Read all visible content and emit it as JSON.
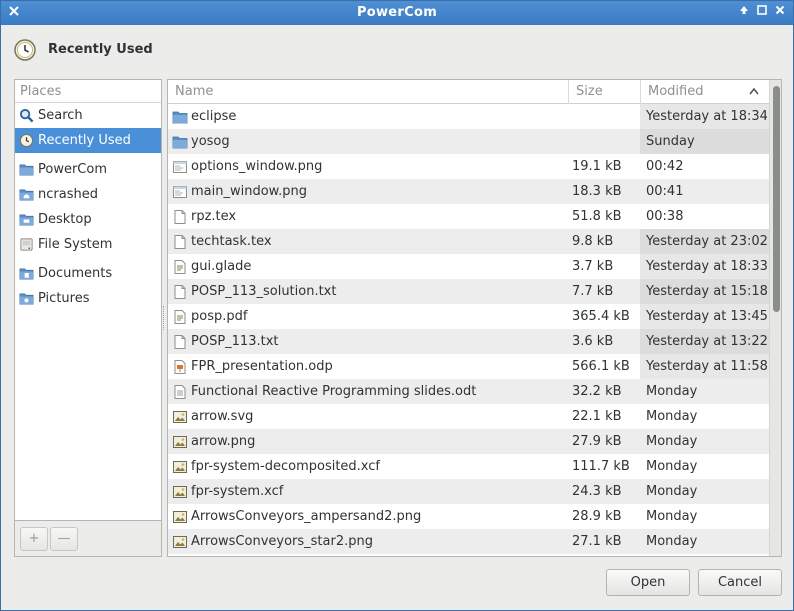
{
  "window": {
    "title": "PowerCom"
  },
  "header": {
    "title": "Recently Used"
  },
  "places": {
    "heading": "Places",
    "items": [
      {
        "label": "Search",
        "icon": "search-icon"
      },
      {
        "label": "Recently Used",
        "icon": "clock-icon",
        "selected": true
      },
      {
        "label": "PowerCom",
        "icon": "folder-icon"
      },
      {
        "label": "ncrashed",
        "icon": "folder-icon"
      },
      {
        "label": "Desktop",
        "icon": "folder-icon"
      },
      {
        "label": "File System",
        "icon": "drive-icon"
      },
      {
        "label": "Documents",
        "icon": "folder-icon"
      },
      {
        "label": "Pictures",
        "icon": "folder-icon"
      }
    ],
    "add_label": "+",
    "remove_label": "—"
  },
  "columns": {
    "name": "Name",
    "size": "Size",
    "modified": "Modified"
  },
  "files": [
    {
      "name": "eclipse",
      "size": "",
      "modified": "Yesterday at 18:34",
      "icon": "folder-icon"
    },
    {
      "name": "yosog",
      "size": "",
      "modified": "Sunday",
      "icon": "folder-icon"
    },
    {
      "name": "options_window.png",
      "size": "19.1 kB",
      "modified": "00:42",
      "icon": "image-icon"
    },
    {
      "name": "main_window.png",
      "size": "18.3 kB",
      "modified": "00:41",
      "icon": "image-icon"
    },
    {
      "name": "rpz.tex",
      "size": "51.8 kB",
      "modified": "00:38",
      "icon": "text-file-icon"
    },
    {
      "name": "techtask.tex",
      "size": "9.8 kB",
      "modified": "Yesterday at 23:02",
      "icon": "text-file-icon"
    },
    {
      "name": "gui.glade",
      "size": "3.7 kB",
      "modified": "Yesterday at 18:33",
      "icon": "script-file-icon"
    },
    {
      "name": "POSP_113_solution.txt",
      "size": "7.7 kB",
      "modified": "Yesterday at 15:18",
      "icon": "text-file-icon"
    },
    {
      "name": "posp.pdf",
      "size": "365.4 kB",
      "modified": "Yesterday at 13:45",
      "icon": "script-file-icon"
    },
    {
      "name": "POSP_113.txt",
      "size": "3.6 kB",
      "modified": "Yesterday at 13:22",
      "icon": "text-file-icon"
    },
    {
      "name": "FPR_presentation.odp",
      "size": "566.1 kB",
      "modified": "Yesterday at 11:58",
      "icon": "presentation-file-icon"
    },
    {
      "name": "Functional Reactive Programming slides.odt",
      "size": "32.2 kB",
      "modified": "Monday",
      "icon": "document-file-icon"
    },
    {
      "name": "arrow.svg",
      "size": "22.1 kB",
      "modified": "Monday",
      "icon": "picture-file-icon"
    },
    {
      "name": "arrow.png",
      "size": "27.9 kB",
      "modified": "Monday",
      "icon": "picture-file-icon"
    },
    {
      "name": "fpr-system-decomposited.xcf",
      "size": "111.7 kB",
      "modified": "Monday",
      "icon": "picture-file-icon"
    },
    {
      "name": "fpr-system.xcf",
      "size": "24.3 kB",
      "modified": "Monday",
      "icon": "picture-file-icon"
    },
    {
      "name": "ArrowsConveyors_ampersand2.png",
      "size": "28.9 kB",
      "modified": "Monday",
      "icon": "picture-file-icon"
    },
    {
      "name": "ArrowsConveyors_star2.png",
      "size": "27.1 kB",
      "modified": "Monday",
      "icon": "picture-file-icon"
    }
  ],
  "buttons": {
    "open": "Open",
    "cancel": "Cancel"
  },
  "colors": {
    "titlebar": "#3a7bc3",
    "selection": "#4a90d9",
    "folder": "#5b8fc9"
  }
}
